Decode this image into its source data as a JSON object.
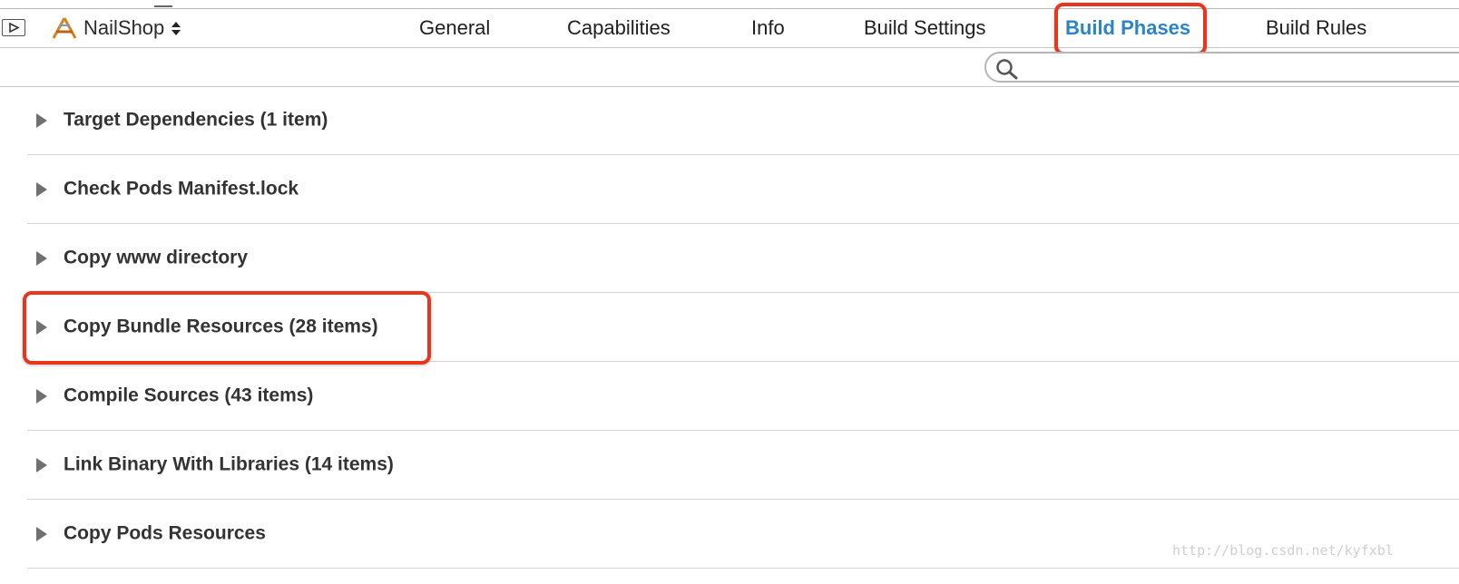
{
  "header": {
    "target_name": "NailShop",
    "tabs": [
      {
        "label": "General"
      },
      {
        "label": "Capabilities"
      },
      {
        "label": "Info"
      },
      {
        "label": "Build Settings"
      },
      {
        "label": "Build Phases",
        "active": true
      },
      {
        "label": "Build Rules"
      }
    ]
  },
  "search": {
    "placeholder": ""
  },
  "phases": [
    {
      "label": "Target Dependencies (1 item)"
    },
    {
      "label": "Check Pods Manifest.lock"
    },
    {
      "label": "Copy www directory"
    },
    {
      "label": "Copy Bundle Resources (28 items)",
      "highlighted": true
    },
    {
      "label": "Compile Sources (43 items)"
    },
    {
      "label": "Link Binary With Libraries (14 items)"
    },
    {
      "label": "Copy Pods Resources"
    }
  ],
  "watermark": "http://blog.csdn.net/kyfxbl",
  "colors": {
    "accent": "#2c84c6",
    "highlight": "#e8351d"
  },
  "icons": {
    "target": "app-target-icon",
    "toggle": "sidebar-toggle-icon",
    "search": "search-icon",
    "disclosure": "disclosure-triangle-icon"
  }
}
